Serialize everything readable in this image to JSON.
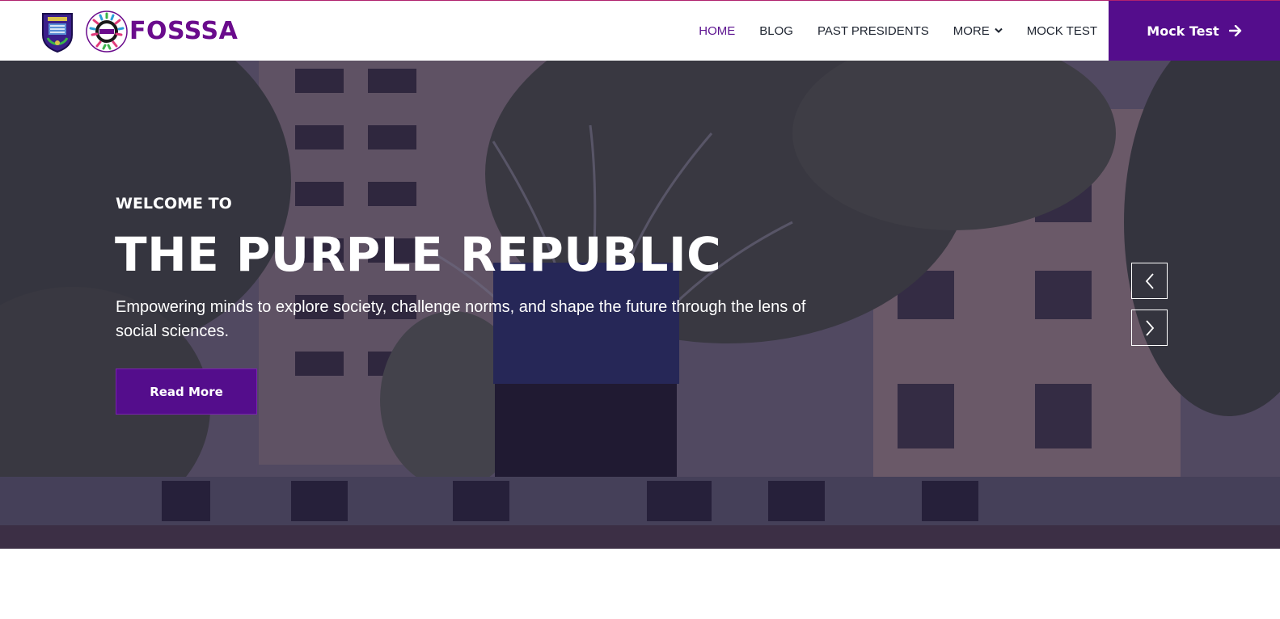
{
  "brand": {
    "name": "FOSSSA",
    "crest_icon": "university-crest-icon",
    "logo_icon": "fosssa-badge-icon",
    "color": "#6a0b8c"
  },
  "nav": {
    "items": [
      {
        "label": "HOME",
        "active": true
      },
      {
        "label": "BLOG",
        "active": false
      },
      {
        "label": "PAST PRESIDENTS",
        "active": false
      },
      {
        "label": "MORE",
        "active": false,
        "icon": "chevron-down-icon"
      },
      {
        "label": "MOCK TEST",
        "active": false
      }
    ]
  },
  "cta": {
    "label": "Mock Test",
    "icon": "arrow-right-icon",
    "color": "#540d8c"
  },
  "hero": {
    "eyebrow": "WELCOME TO",
    "title": "THE PURPLE REPUBLIC",
    "tagline": "Empowering minds to explore society, challenge norms, and shape the future through the lens of social sciences.",
    "button_label": "Read More",
    "prev_icon": "chevron-left-icon",
    "next_icon": "chevron-right-icon"
  }
}
